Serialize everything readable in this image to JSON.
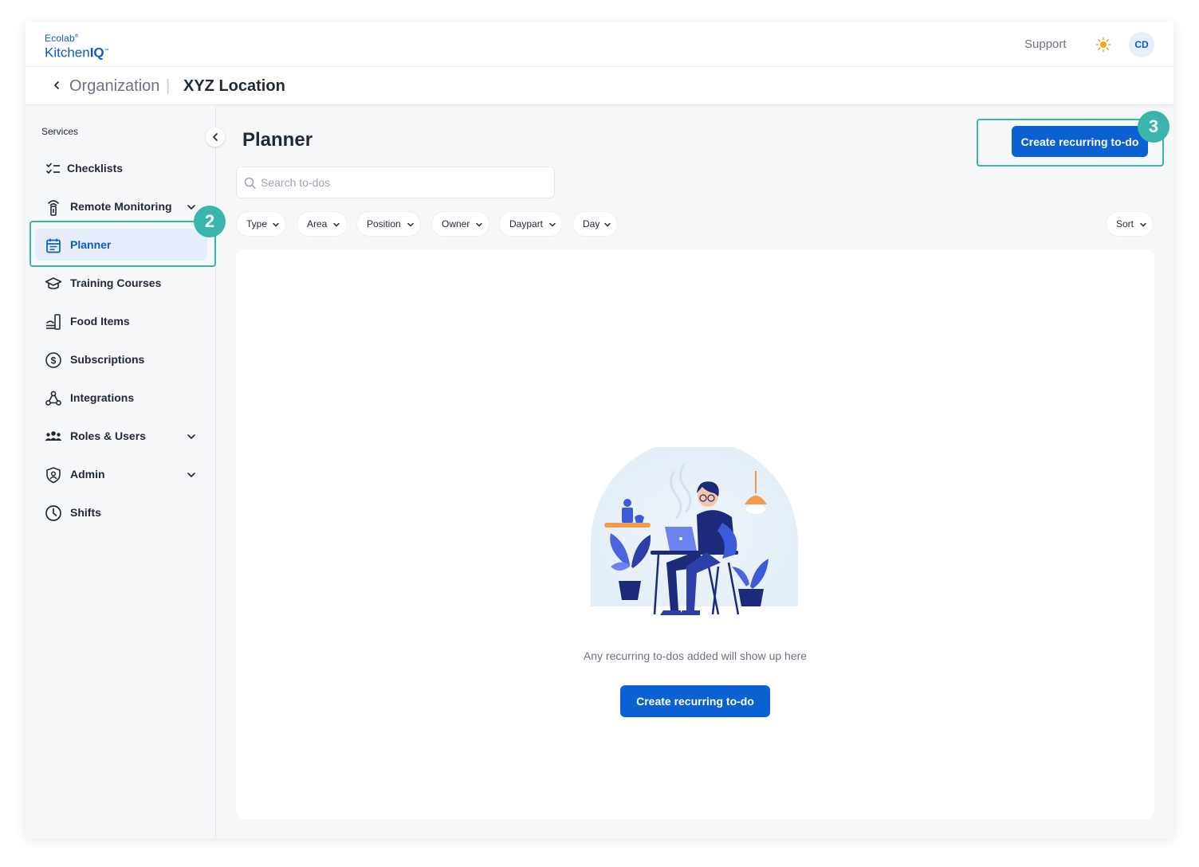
{
  "brand": {
    "line1": "Ecolab",
    "line2_a": "Kitchen",
    "line2_b": "IQ",
    "tm": "™",
    "reg": "®"
  },
  "header": {
    "support": "Support",
    "theme_icon": "sun-icon",
    "avatar": "CD"
  },
  "breadcrumb": {
    "back_icon": "chevron-left-icon",
    "organization": "Organization",
    "separator": "|",
    "location": "XYZ Location"
  },
  "sidebar": {
    "title": "Services",
    "items": [
      {
        "label": "Checklists",
        "icon": "checklist-icon"
      },
      {
        "label": "Remote Monitoring",
        "icon": "sensor-icon",
        "expandable": true
      },
      {
        "label": "Planner",
        "icon": "calendar-icon",
        "active": true
      },
      {
        "label": "Training Courses",
        "icon": "graduation-cap-icon"
      },
      {
        "label": "Food Items",
        "icon": "food-tray-icon"
      },
      {
        "label": "Subscriptions",
        "icon": "dollar-circle-icon"
      },
      {
        "label": "Integrations",
        "icon": "webhook-icon"
      },
      {
        "label": "Roles & Users",
        "icon": "users-icon",
        "expandable": true
      },
      {
        "label": "Admin",
        "icon": "shield-icon",
        "expandable": true
      },
      {
        "label": "Shifts",
        "icon": "clock-icon"
      }
    ]
  },
  "main": {
    "title": "Planner",
    "primary_button": "Create recurring to-do",
    "search": {
      "placeholder": "Search to-dos",
      "value": ""
    },
    "filters": [
      "Type",
      "Area",
      "Position",
      "Owner",
      "Daypart",
      "Day"
    ],
    "sort": "Sort",
    "empty_state": {
      "message": "Any recurring to-dos added will show up here",
      "button": "Create recurring to-do",
      "illustration": "person-at-laptop-illustration"
    }
  },
  "callouts": {
    "planner_step": "2",
    "create_step": "3"
  },
  "colors": {
    "primary": "#0b61d1",
    "accent_teal": "#39b5ac",
    "active_bg": "#e6eefb",
    "background": "#f6f7f9"
  }
}
